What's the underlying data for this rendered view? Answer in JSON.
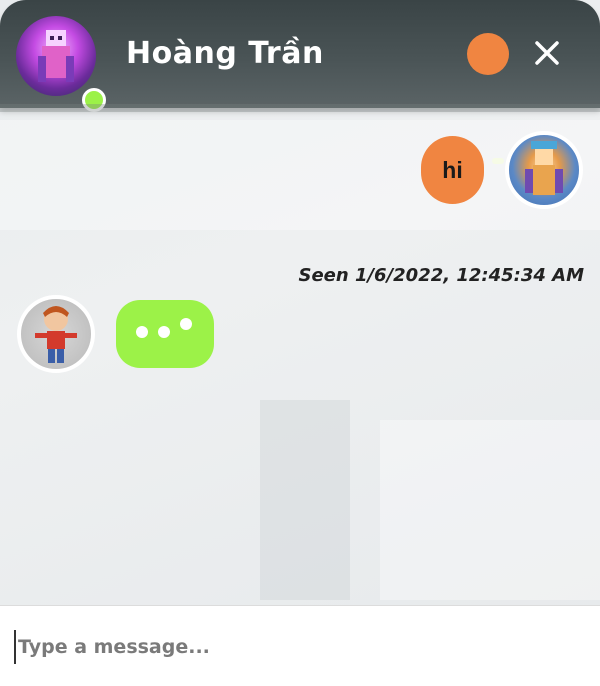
{
  "header": {
    "title": "Hoàng Trần",
    "avatar_icon": "user-avatar-icon",
    "status": "online",
    "close_glyph": "✕"
  },
  "messages": {
    "sent_text": "hi",
    "seen_text": "Seen 1/6/2022, 12:45:34 AM",
    "typing_indicator": "typing"
  },
  "composer": {
    "placeholder": "Type a message..."
  },
  "colors": {
    "accent_orange": "#f08541",
    "accent_green": "#9cf248",
    "header_bg": "#4a5456",
    "background": "#eceff0"
  }
}
